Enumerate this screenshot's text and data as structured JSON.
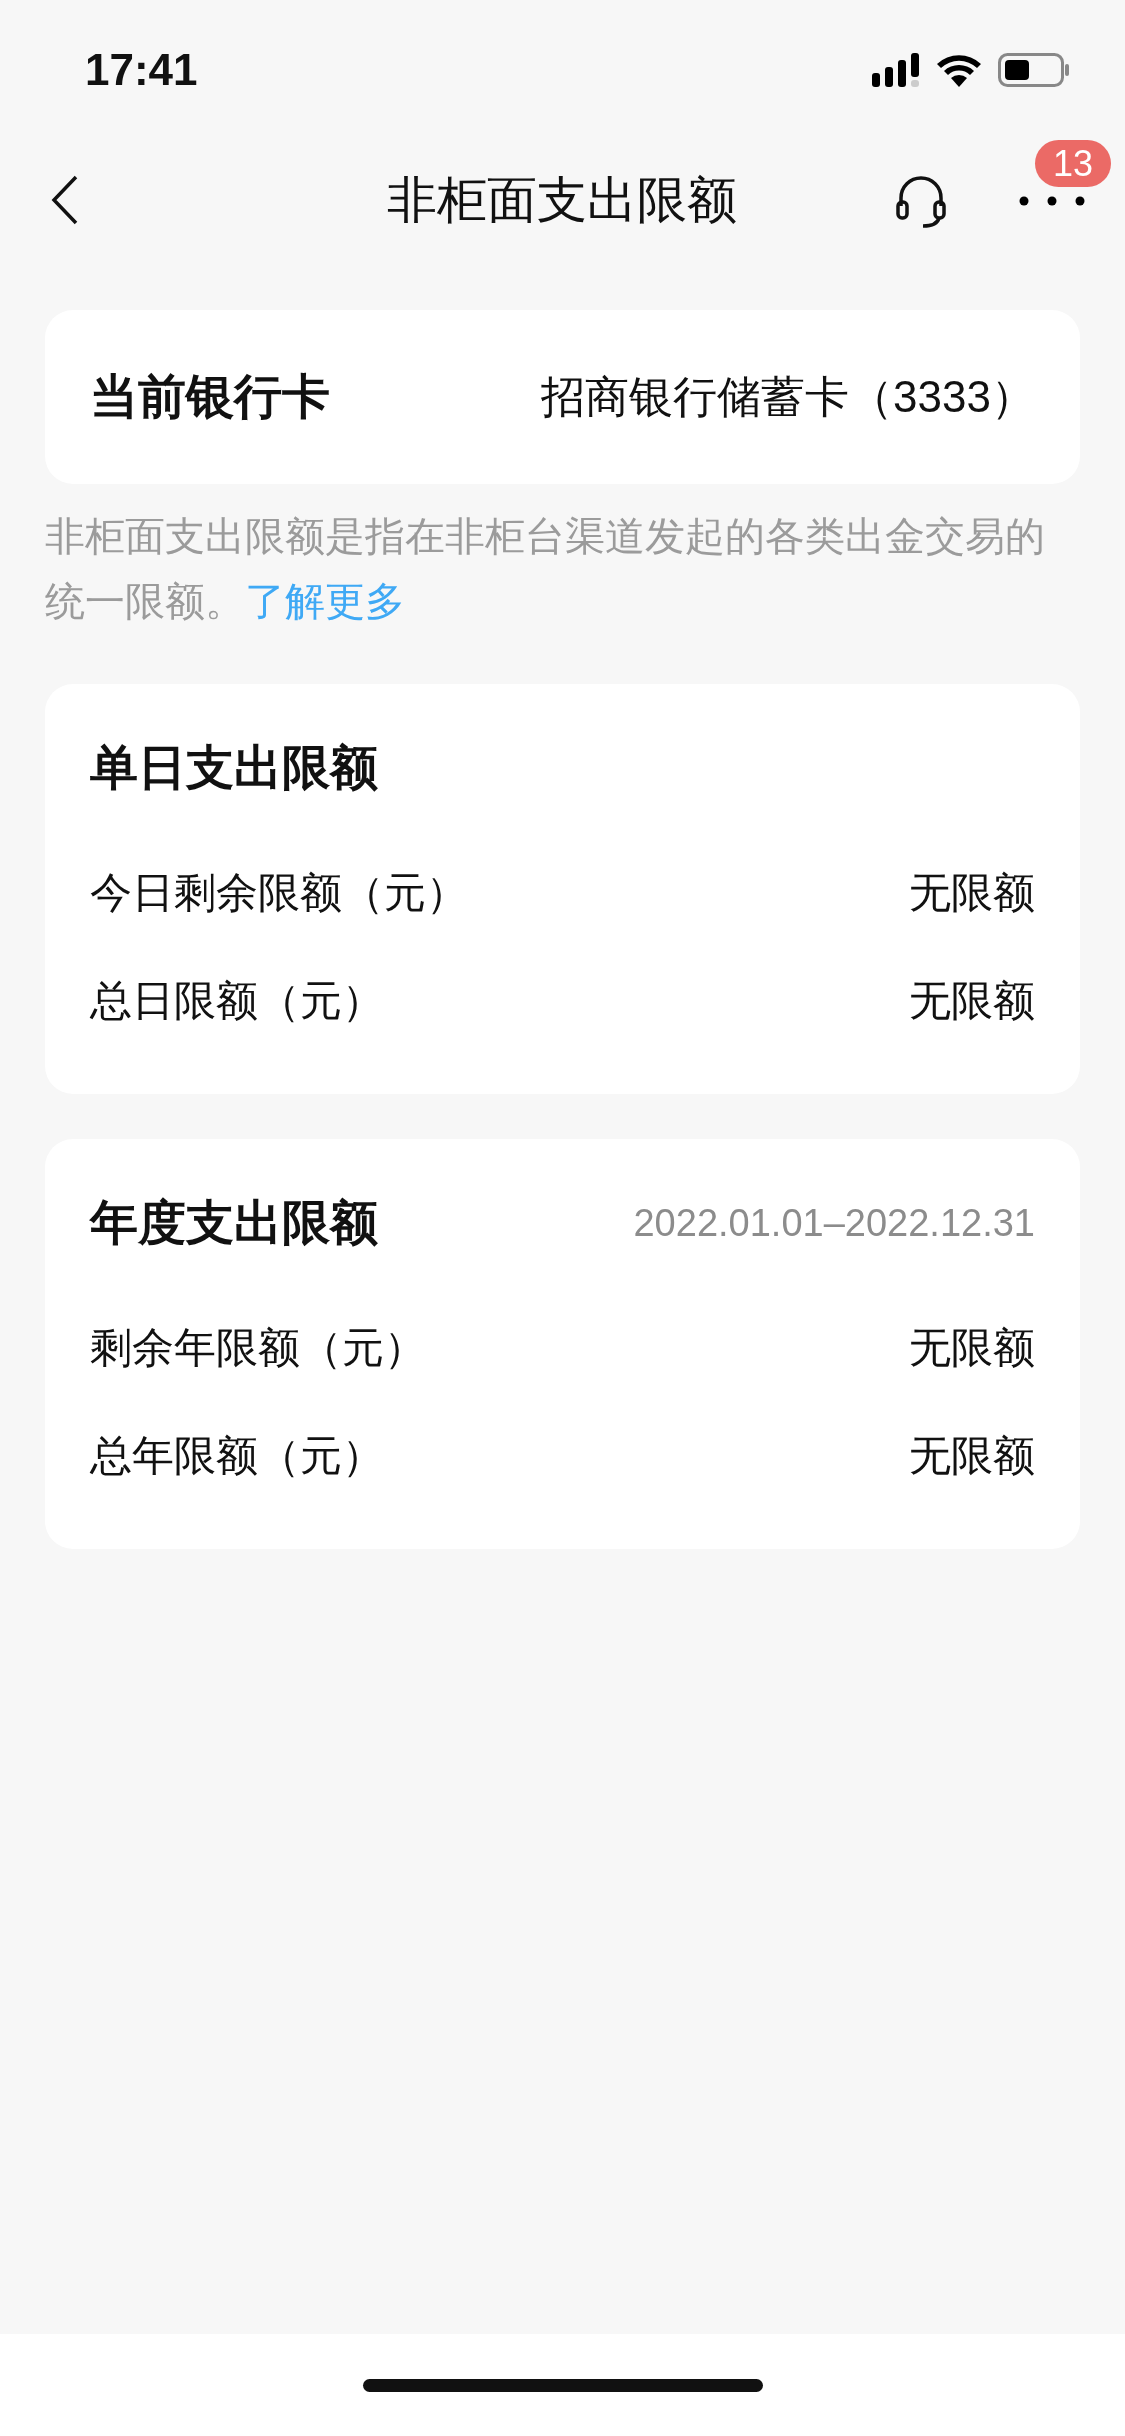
{
  "status_bar": {
    "time": "17:41"
  },
  "nav_bar": {
    "title": "非柜面支出限额",
    "badge": "13"
  },
  "current_card": {
    "label": "当前银行卡",
    "value": "招商银行储蓄卡（3333）"
  },
  "description": {
    "text": "非柜面支出限额是指在非柜台渠道发起的各类出金交易的统一限额。",
    "link": "了解更多"
  },
  "sections": [
    {
      "title": "单日支出限额",
      "rows": [
        {
          "label": "今日剩余限额（元）",
          "value": "无限额"
        },
        {
          "label": "总日限额（元）",
          "value": "无限额"
        }
      ]
    },
    {
      "title": "年度支出限额",
      "period": "2022.01.01–2022.12.31",
      "rows": [
        {
          "label": "剩余年限额（元）",
          "value": "无限额"
        },
        {
          "label": "总年限额（元）",
          "value": "无限额"
        }
      ]
    }
  ]
}
